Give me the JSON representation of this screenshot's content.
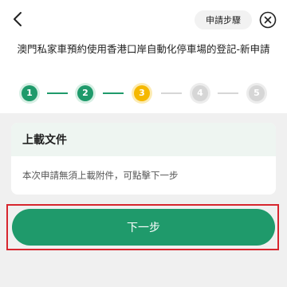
{
  "header": {
    "back_icon": "chevron-left-icon",
    "steps_button_label": "申請步驟",
    "close_icon": "close-circle-icon"
  },
  "page_title": "澳門私家車預約使用香港口岸自動化停車場的登記-新申請",
  "stepper": {
    "steps": [
      {
        "label": "1",
        "status": "done"
      },
      {
        "label": "2",
        "status": "done"
      },
      {
        "label": "3",
        "status": "active"
      },
      {
        "label": "4",
        "status": "pending"
      },
      {
        "label": "5",
        "status": "pending"
      }
    ],
    "colors": {
      "done": "#1f9a6b",
      "active": "#f5b800",
      "pending": "#d6d6d6"
    }
  },
  "upload_card": {
    "title": "上載文件",
    "message": "本次申請無須上載附件，可點擊下一步"
  },
  "next_button_label": "下一步",
  "colors": {
    "primary": "#1f9a6b",
    "highlight": "#d7262e"
  }
}
